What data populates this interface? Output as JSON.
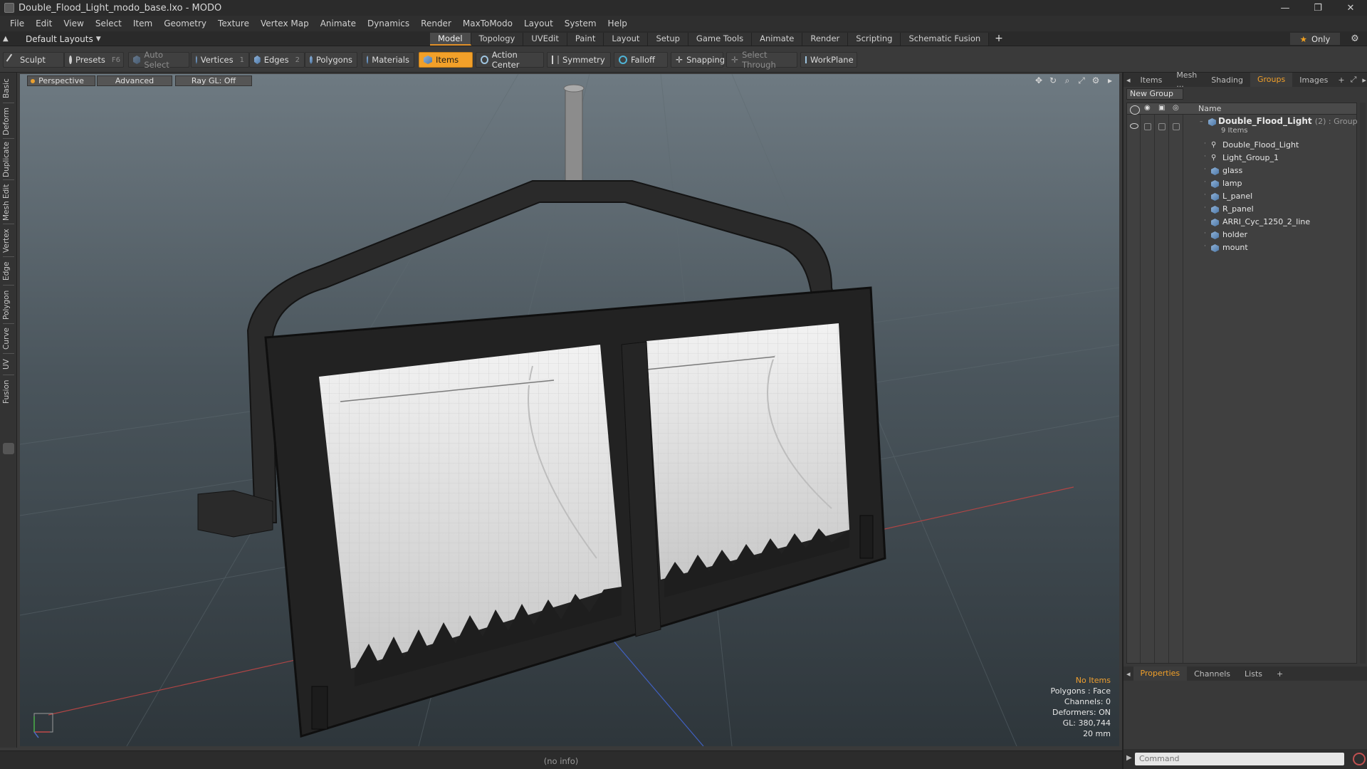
{
  "window": {
    "title": "Double_Flood_Light_modo_base.lxo - MODO",
    "controls": [
      "—",
      "❐",
      "✕"
    ]
  },
  "menu": [
    "File",
    "Edit",
    "View",
    "Select",
    "Item",
    "Geometry",
    "Texture",
    "Vertex Map",
    "Animate",
    "Dynamics",
    "Render",
    "MaxToModo",
    "Layout",
    "System",
    "Help"
  ],
  "layout_dropdown": "Default Layouts",
  "tabs": [
    "Model",
    "Topology",
    "UVEdit",
    "Paint",
    "Layout",
    "Setup",
    "Game Tools",
    "Animate",
    "Render",
    "Scripting",
    "Schematic Fusion"
  ],
  "active_tab": "Model",
  "only_button": "Only",
  "toolbar": {
    "sculpt": "Sculpt",
    "presets": "Presets",
    "presets_key": "F6",
    "auto_select": "Auto Select",
    "vertices": "Vertices",
    "vertices_count": "1",
    "edges": "Edges",
    "edges_count": "2",
    "polygons": "Polygons",
    "materials": "Materials",
    "items": "Items",
    "action_center": "Action Center",
    "symmetry": "Symmetry",
    "falloff": "Falloff",
    "snapping": "Snapping",
    "select_through": "Select Through",
    "workplane": "WorkPlane"
  },
  "left_tabs": [
    "Basic",
    "Deform",
    "Duplicate",
    "Mesh Edit",
    "Vertex",
    "Edge",
    "Polygon",
    "Curve",
    "UV",
    "Fusion"
  ],
  "viewport": {
    "perspective": "Perspective",
    "advanced": "Advanced",
    "raygl": "Ray GL: Off",
    "stats": {
      "no_items": "No Items",
      "polygons": "Polygons : Face",
      "channels": "Channels: 0",
      "deformers": "Deformers: ON",
      "gl": "GL: 380,744",
      "scale": "20 mm"
    }
  },
  "status_info": "(no info)",
  "right_panel": {
    "tabs": [
      "Items",
      "Mesh ...",
      "Shading",
      "Groups",
      "Images"
    ],
    "active_tab": "Groups",
    "new_group": "New Group",
    "name_header": "Name",
    "group": {
      "name": "Double_Flood_Light",
      "suffix": "(2) : Group",
      "sub": "9 Items"
    },
    "items": [
      "Double_Flood_Light",
      "Light_Group_1",
      "glass",
      "lamp",
      "L_panel",
      "R_panel",
      "ARRI_Cyc_1250_2_line",
      "holder",
      "mount"
    ]
  },
  "bottom_panel": {
    "tabs": [
      "Properties",
      "Channels",
      "Lists"
    ],
    "active_tab": "Properties",
    "command_placeholder": "Command"
  },
  "colors": {
    "accent": "#f2a029",
    "background": "#3a3a3a"
  }
}
